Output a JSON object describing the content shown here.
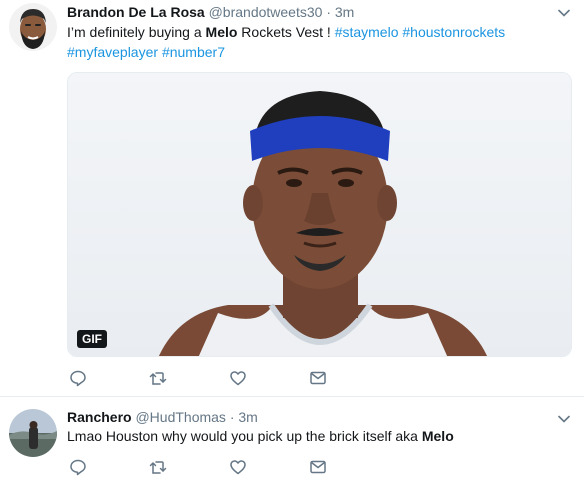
{
  "tweets": [
    {
      "fullname": "Brandon De La Rosa",
      "handle": "@brandotweets30",
      "separator": "·",
      "time": "3m",
      "text_lines": [
        [
          {
            "t": "I’m definitely buying a ",
            "k": "plain"
          },
          {
            "t": "Melo",
            "k": "bold"
          },
          {
            "t": " Rockets Vest ! ",
            "k": "plain"
          },
          {
            "t": "#staymelo",
            "k": "hashtag"
          },
          {
            "t": " ",
            "k": "plain"
          },
          {
            "t": "#houstonrockets",
            "k": "hashtag"
          }
        ],
        [
          {
            "t": "#myfaveplayer",
            "k": "hashtag"
          },
          {
            "t": " ",
            "k": "plain"
          },
          {
            "t": "#number7",
            "k": "hashtag"
          }
        ]
      ],
      "media_badge": "GIF",
      "actions": [
        "reply-icon",
        "retweet-icon",
        "like-icon",
        "direct-message-icon"
      ]
    },
    {
      "fullname": "Ranchero",
      "handle": "@HudThomas",
      "separator": "·",
      "time": "3m",
      "text_lines": [
        [
          {
            "t": "Lmao Houston why would you pick up the brick itself aka ",
            "k": "plain"
          },
          {
            "t": "Melo",
            "k": "bold"
          }
        ]
      ],
      "actions": [
        "reply-icon",
        "retweet-icon",
        "like-icon",
        "direct-message-icon"
      ]
    }
  ],
  "colors": {
    "text": "#14171a",
    "secondary": "#657786",
    "link": "#1b95e0",
    "divider": "#e6ecf0",
    "headband": "#1f3fbf"
  },
  "icons": {
    "caret": "chevron-down-icon",
    "media_play_badge": "gif-badge"
  }
}
